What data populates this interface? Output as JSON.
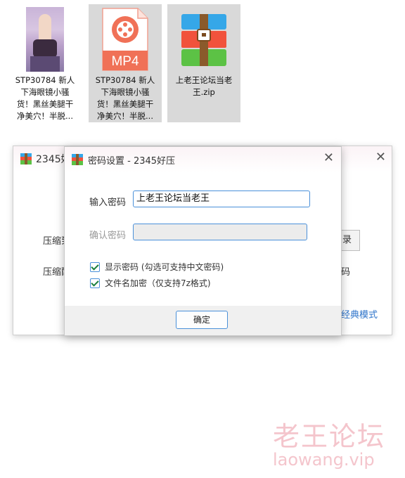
{
  "files": [
    {
      "name": "STP30784 新人\n下海眼镜小骚\n货！黑丝美腿干\n净美穴！半脱...",
      "icon": "photo-thumbnail",
      "selected": false
    },
    {
      "name": "STP30784 新人\n下海眼镜小骚\n货！黑丝美腿干\n净美穴！半脱...",
      "icon": "mp4-file-icon",
      "icon_text": "MP4",
      "selected": true
    },
    {
      "name": "上老王论坛当老\n王.zip",
      "icon": "zip-archive-icon",
      "selected": true
    }
  ],
  "background_dialog": {
    "title": "2345好",
    "label1": "压缩到",
    "label2": "压缩配",
    "browse_partial": "录",
    "right_label_partial": "码",
    "classic_mode": "经典模式"
  },
  "dialog": {
    "title": "密码设置 - 2345好压",
    "password_label": "输入密码",
    "password_value": "上老王论坛当老王",
    "confirm_label": "确认密码",
    "confirm_value": "",
    "show_password_label": "显示密码 (勾选可支持中文密码)",
    "show_password_checked": true,
    "encrypt_names_label": "文件名加密（仅支持7z格式)",
    "encrypt_names_checked": true,
    "ok_button": "确定"
  },
  "watermark": {
    "line1": "老王论坛",
    "line2": "laowang.vip"
  },
  "colors": {
    "accent": "#4a90d9",
    "mp4_orange": "#f07157",
    "watermark": "#f4c5cc"
  }
}
